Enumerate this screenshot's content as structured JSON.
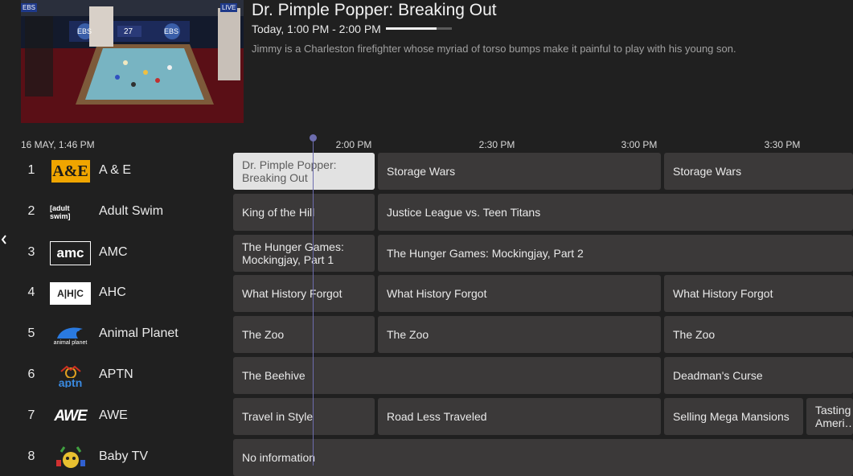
{
  "preview": {
    "scoreboard": {
      "left_badge": "EBS",
      "score": "27",
      "right_badge": "EBS",
      "live": "LIVE"
    }
  },
  "program": {
    "title": "Dr. Pimple Popper: Breaking Out",
    "time": "Today, 1:00 PM - 2:00 PM",
    "progress": 0.77,
    "description": "Jimmy is a Charleston firefighter whose myriad of torso bumps make it painful to play with his young son."
  },
  "guide": {
    "datetime": "16 MAY, 1:46 PM",
    "times": [
      "2:00 PM",
      "2:30 PM",
      "3:00 PM",
      "3:30 PM"
    ],
    "channels": [
      {
        "number": "1",
        "name": "A & E",
        "logo": "A&E",
        "logo_icon": "ae-logo-icon",
        "programs": [
          {
            "title": "Dr. Pimple Popper:\nBreaking Out",
            "current": true
          },
          {
            "title": "Storage Wars"
          },
          {
            "title": "Storage Wars"
          }
        ]
      },
      {
        "number": "2",
        "name": "Adult Swim",
        "logo": "[adult swim]",
        "logo_icon": "adult-swim-logo-icon",
        "programs": [
          {
            "title": "King of the Hill"
          },
          {
            "title": "Justice League vs. Teen Titans"
          }
        ]
      },
      {
        "number": "3",
        "name": "AMC",
        "logo": "amc",
        "logo_icon": "amc-logo-icon",
        "programs": [
          {
            "title": "The Hunger Games:\nMockingjay, Part 1"
          },
          {
            "title": "The Hunger Games: Mockingjay, Part 2"
          }
        ]
      },
      {
        "number": "4",
        "name": "AHC",
        "logo": "A|H|C",
        "logo_icon": "ahc-logo-icon",
        "programs": [
          {
            "title": "What History Forgot"
          },
          {
            "title": "What History Forgot"
          },
          {
            "title": "What History Forgot"
          }
        ]
      },
      {
        "number": "5",
        "name": "Animal Planet",
        "logo": "animal planet",
        "logo_icon": "animal-planet-logo-icon",
        "programs": [
          {
            "title": "The Zoo"
          },
          {
            "title": "The Zoo"
          },
          {
            "title": "The Zoo"
          }
        ]
      },
      {
        "number": "6",
        "name": "APTN",
        "logo": "aptn",
        "logo_icon": "aptn-logo-icon",
        "programs": [
          {
            "title": "The Beehive"
          },
          {
            "title": "Deadman's Curse"
          }
        ]
      },
      {
        "number": "7",
        "name": "AWE",
        "logo": "AWE",
        "logo_icon": "awe-logo-icon",
        "programs": [
          {
            "title": "Travel in Style"
          },
          {
            "title": "Road Less Traveled"
          },
          {
            "title": "Selling Mega Mansions"
          },
          {
            "title": "Tasting\nAmeri…"
          }
        ]
      },
      {
        "number": "8",
        "name": "Baby TV",
        "logo": "",
        "logo_icon": "baby-tv-logo-icon",
        "programs": [
          {
            "title": "No information"
          }
        ]
      }
    ]
  },
  "colors": {
    "accent_line": "#6d6dae",
    "cell": "#3b3939",
    "current_cell": "#e2e2e2"
  },
  "icons": {
    "back": "chevron-left-icon"
  }
}
